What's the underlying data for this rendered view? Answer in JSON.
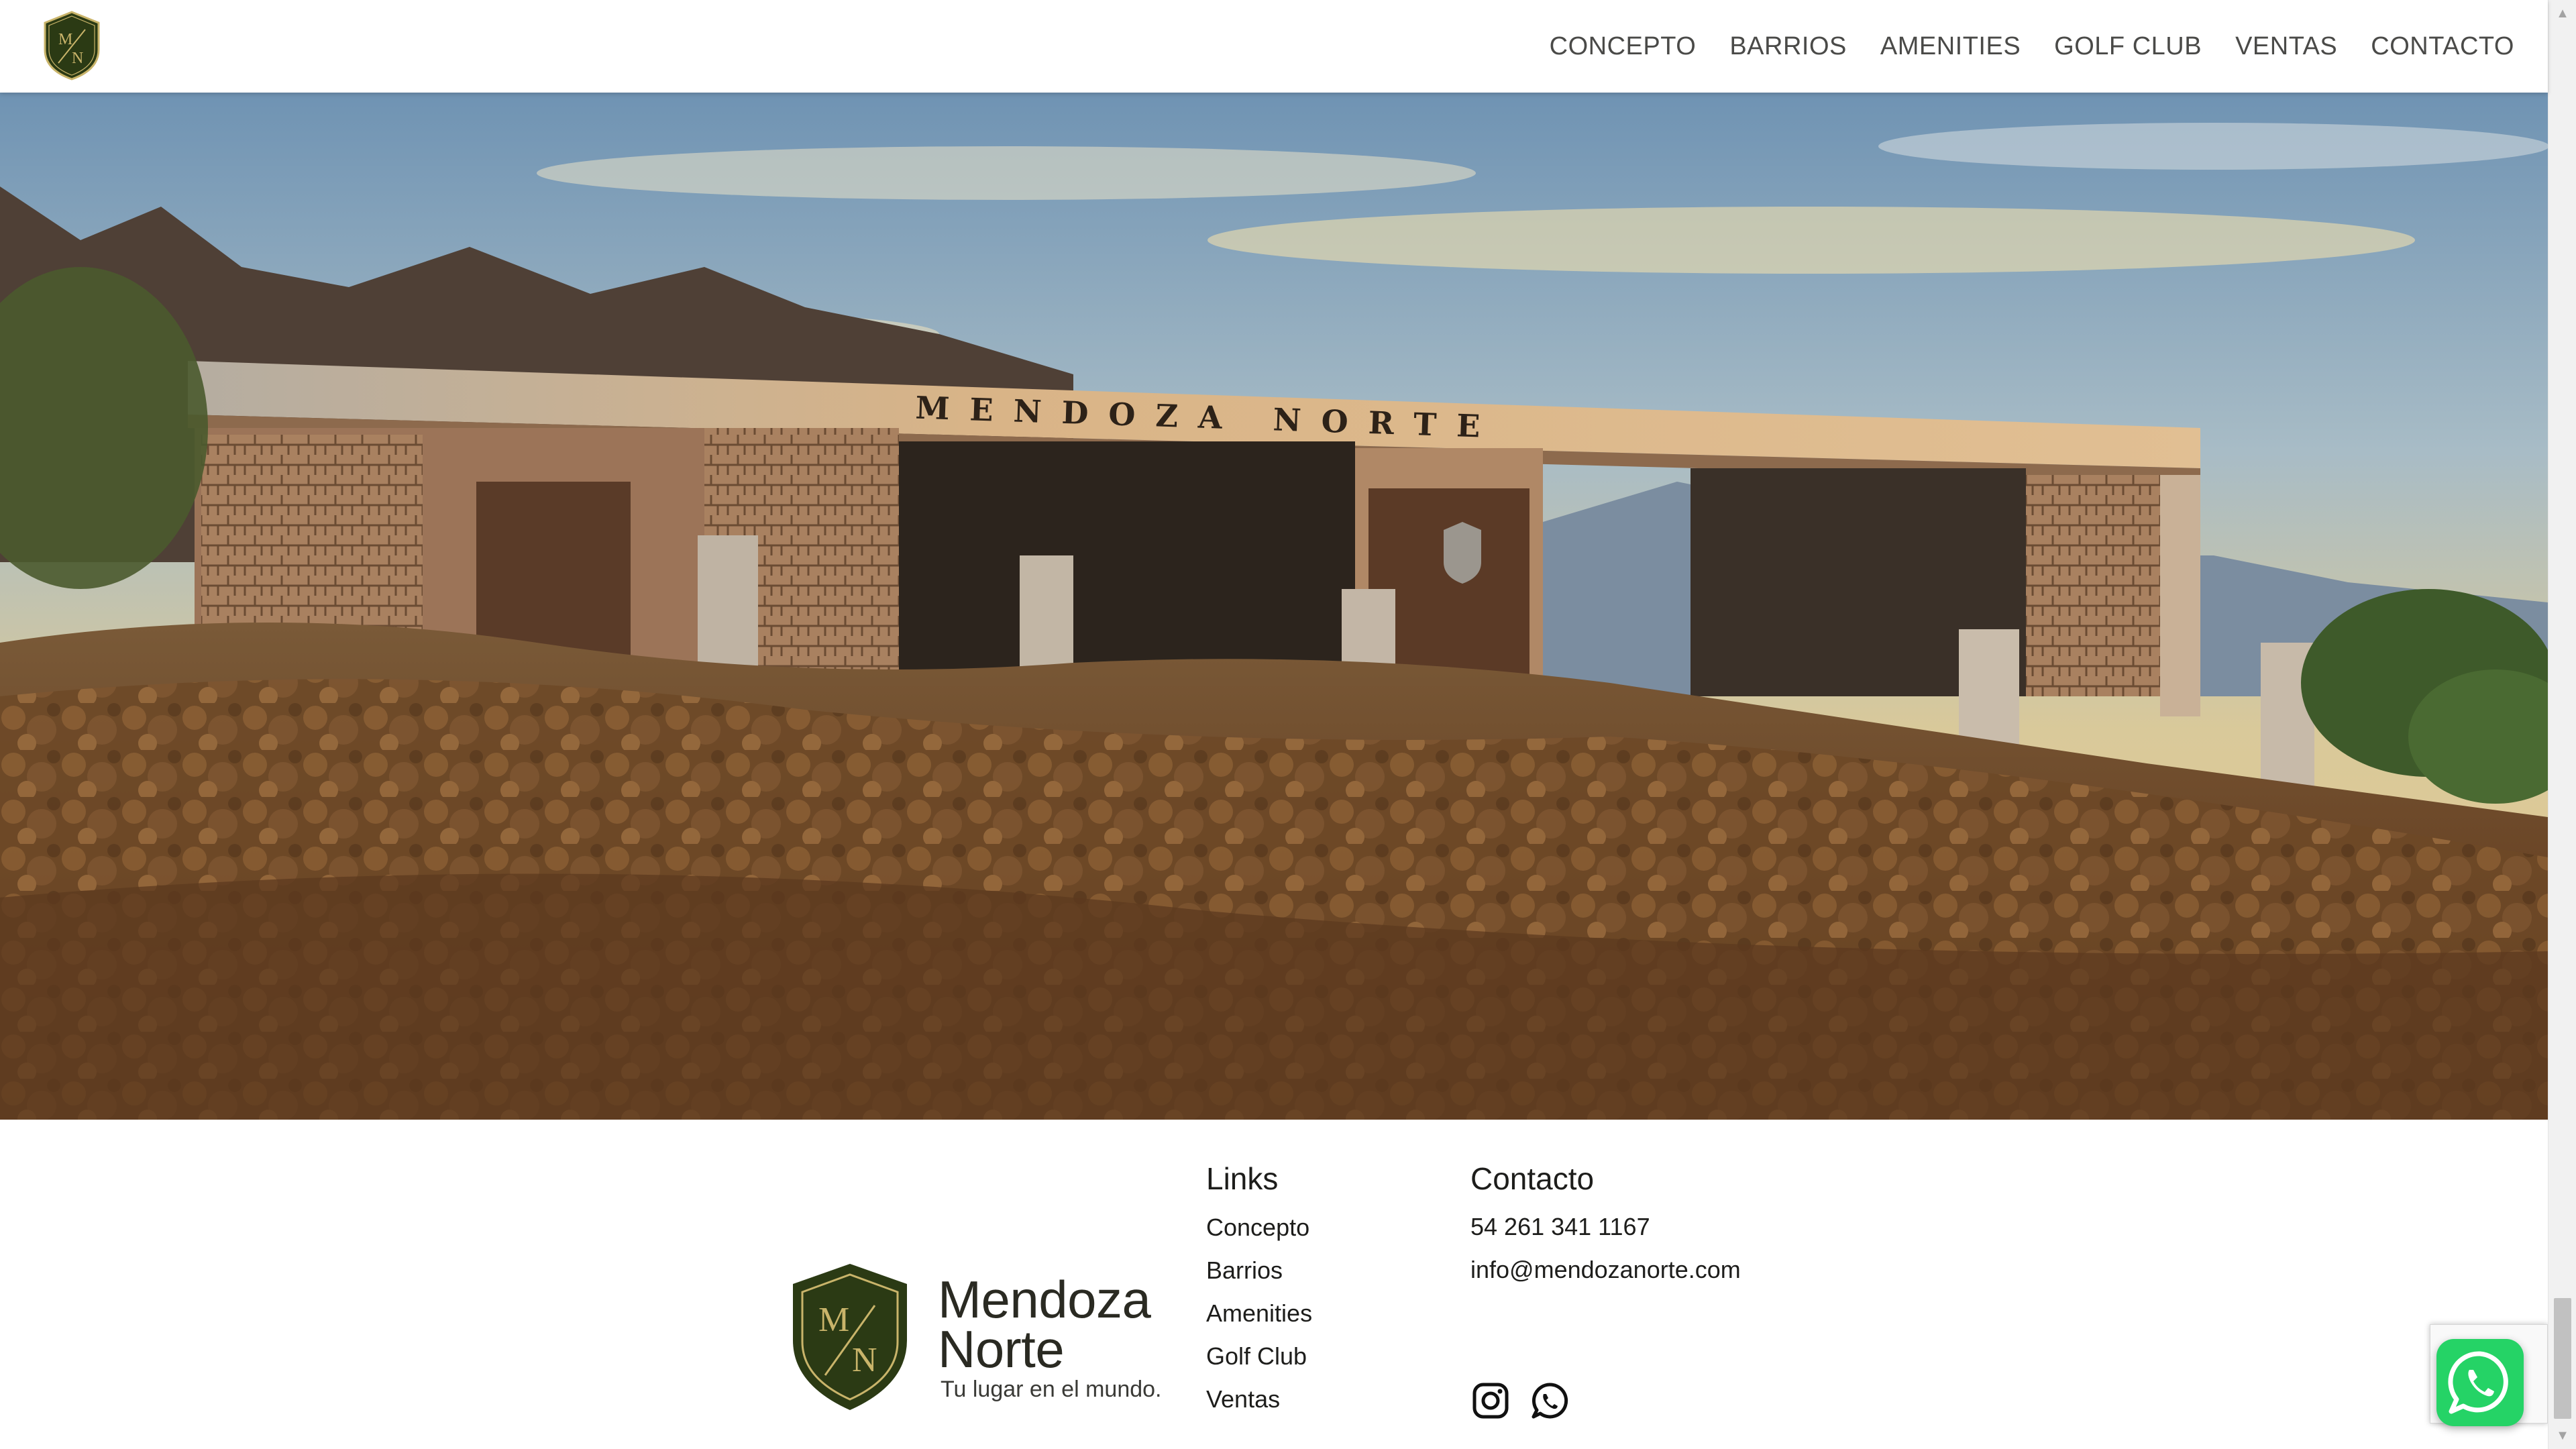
{
  "header": {
    "logo_icon": "mendoza-norte-shield-logo",
    "nav": [
      {
        "label": "CONCEPTO"
      },
      {
        "label": "BARRIOS"
      },
      {
        "label": "AMENITIES"
      },
      {
        "label": "GOLF CLUB"
      },
      {
        "label": "VENTAS"
      },
      {
        "label": "CONTACTO"
      }
    ]
  },
  "hero": {
    "sign_text": "MENDOZA NORTE"
  },
  "footer": {
    "brand": {
      "monogram_top": "M",
      "monogram_bottom": "N",
      "name_line1": "Mendoza",
      "name_line2": "Norte",
      "tagline": "Tu lugar en el mundo."
    },
    "links": {
      "title": "Links",
      "items": [
        {
          "label": "Concepto"
        },
        {
          "label": "Barrios"
        },
        {
          "label": "Amenities"
        },
        {
          "label": "Golf Club"
        },
        {
          "label": "Ventas"
        }
      ]
    },
    "contact": {
      "title": "Contacto",
      "phone": "54 261 341 1167",
      "email": "info@mendozanorte.com"
    },
    "social": [
      {
        "icon": "instagram-icon"
      },
      {
        "icon": "whatsapp-icon"
      }
    ]
  },
  "colors": {
    "brand_dark_green": "#2b3a14",
    "brand_gold": "#c9b46a",
    "whatsapp_green": "#25d366",
    "nav_text": "#4a4a48"
  }
}
